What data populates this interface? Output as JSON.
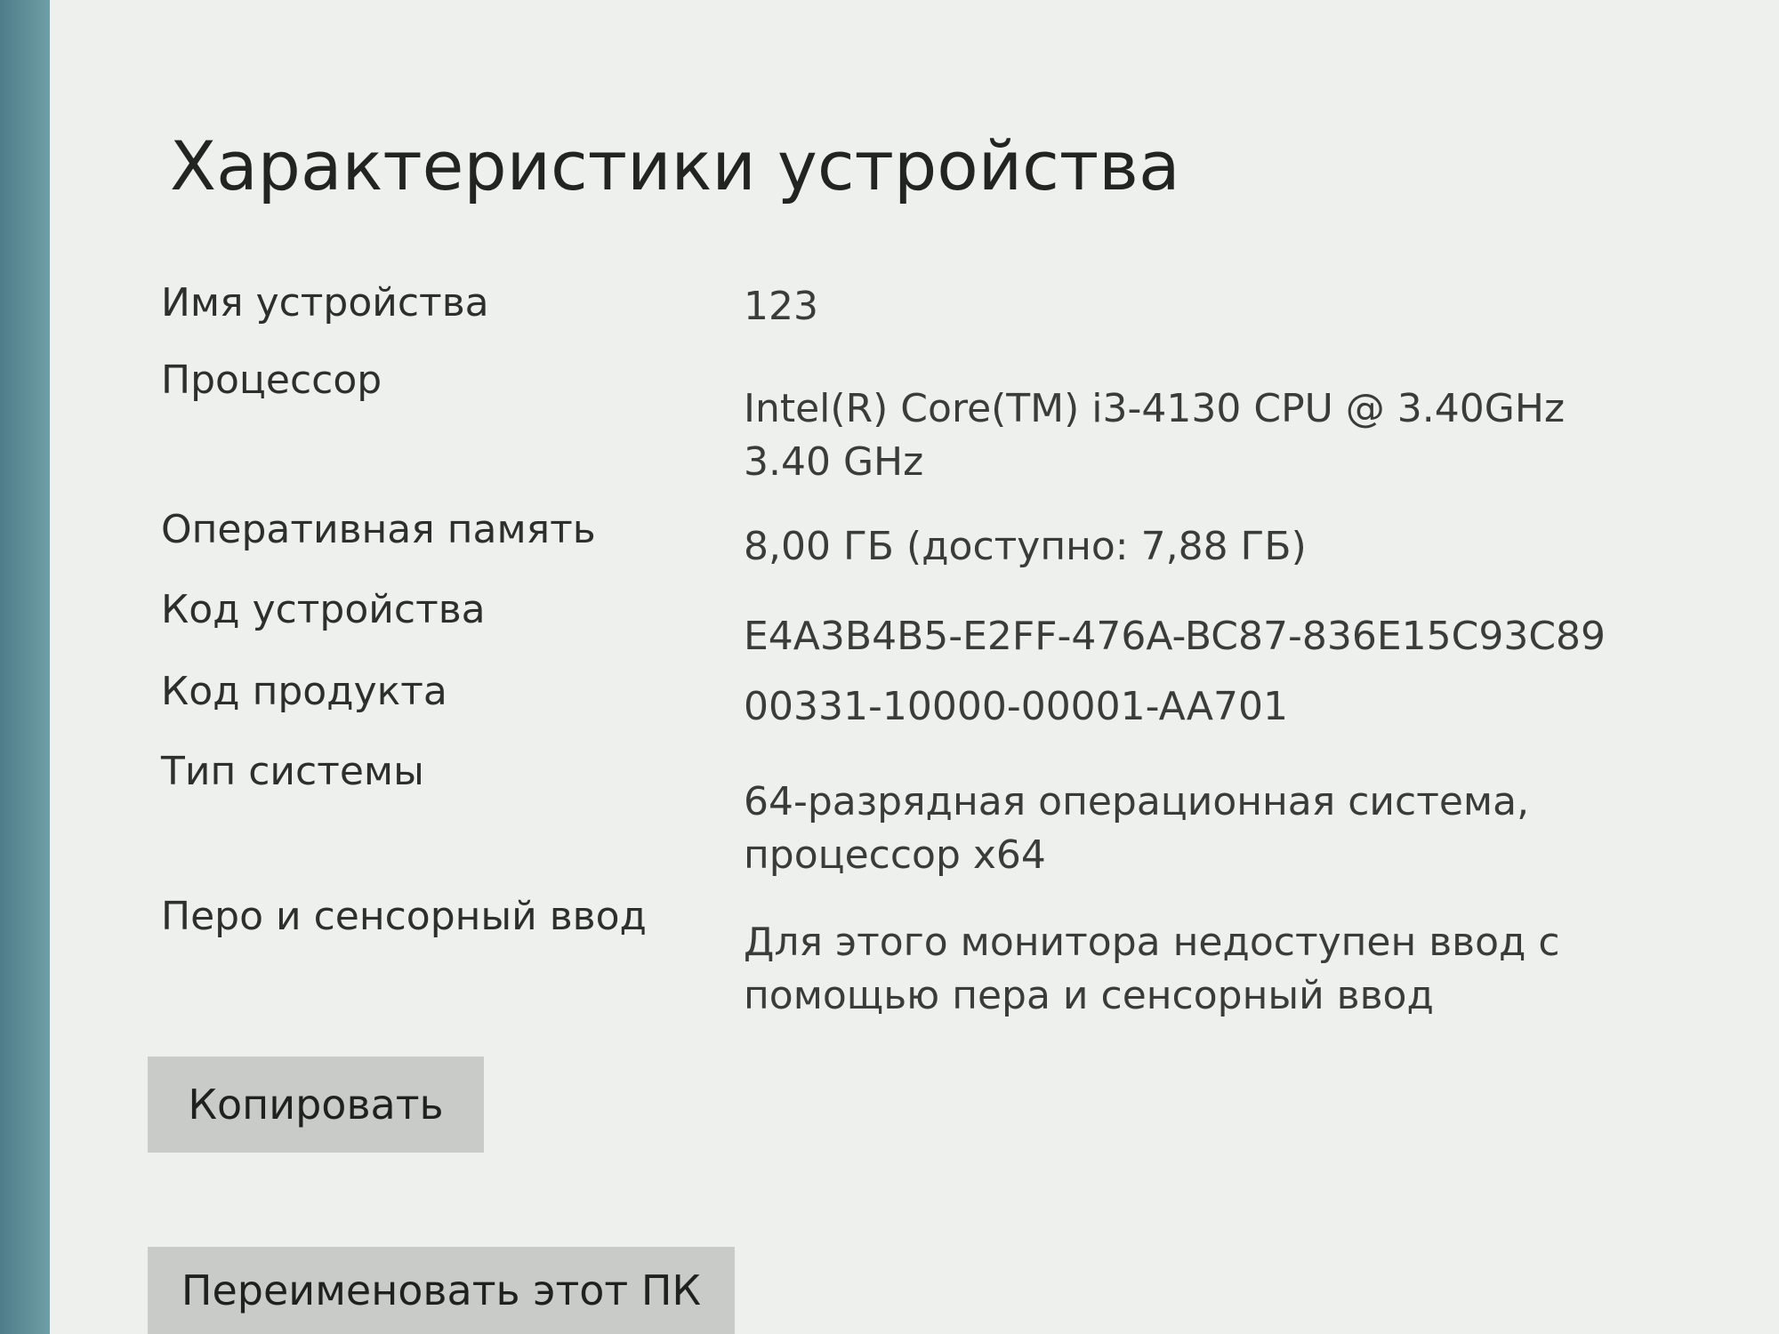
{
  "section_title": "Характеристики устройства",
  "specs": [
    {
      "label": "Имя устройства",
      "value": "123"
    },
    {
      "label": "Процессор",
      "value": "Intel(R) Core(TM) i3-4130 CPU @ 3.40GHz 3.40 GHz"
    },
    {
      "label": "Оперативная память",
      "value": "8,00 ГБ (доступно: 7,88 ГБ)"
    },
    {
      "label": "Код устройства",
      "value": "E4A3B4B5-E2FF-476A-BC87-836E15C93C89"
    },
    {
      "label": "Код продукта",
      "value": "00331-10000-00001-AA701"
    },
    {
      "label": "Тип системы",
      "value": "64-разрядная операционная система, процессор x64"
    },
    {
      "label": "Перо и сенсорный ввод",
      "value": "Для этого монитора недоступен ввод с помощью пера и сенсорный ввод"
    }
  ],
  "buttons": {
    "copy_label": "Копировать",
    "rename_label": "Переименовать этот ПК"
  },
  "colors": {
    "panel_background": "#eef0ed",
    "button_background": "#c9cbc8",
    "window_edge": "#5f8e98"
  }
}
